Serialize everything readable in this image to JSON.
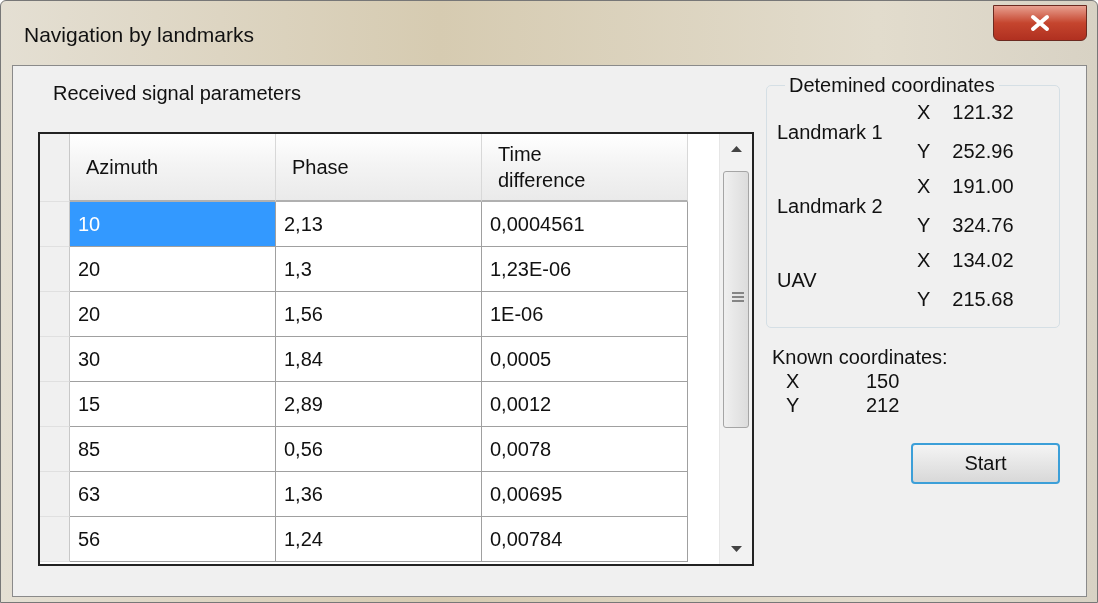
{
  "window": {
    "title": "Navigation by landmarks"
  },
  "section_label": "Received signal parameters",
  "table": {
    "columns": [
      "Azimuth",
      "Phase",
      "Time difference"
    ],
    "rows": [
      {
        "cells": [
          {
            "text": "10",
            "selected": true
          },
          {
            "text": "2,13",
            "selected": false
          },
          {
            "text": "0,0004561",
            "selected": false
          }
        ]
      },
      {
        "cells": [
          {
            "text": "20",
            "selected": false
          },
          {
            "text": "1,3",
            "selected": false
          },
          {
            "text": "1,23E-06",
            "selected": false
          }
        ]
      },
      {
        "cells": [
          {
            "text": "20",
            "selected": false
          },
          {
            "text": "1,56",
            "selected": false
          },
          {
            "text": "1E-06",
            "selected": false
          }
        ]
      },
      {
        "cells": [
          {
            "text": "30",
            "selected": false
          },
          {
            "text": "1,84",
            "selected": false
          },
          {
            "text": "0,0005",
            "selected": false
          }
        ]
      },
      {
        "cells": [
          {
            "text": "15",
            "selected": false
          },
          {
            "text": "2,89",
            "selected": false
          },
          {
            "text": "0,0012",
            "selected": false
          }
        ]
      },
      {
        "cells": [
          {
            "text": "85",
            "selected": false
          },
          {
            "text": "0,56",
            "selected": false
          },
          {
            "text": "0,0078",
            "selected": false
          }
        ]
      },
      {
        "cells": [
          {
            "text": "63",
            "selected": false
          },
          {
            "text": "1,36",
            "selected": false
          },
          {
            "text": "0,00695",
            "selected": false
          }
        ]
      },
      {
        "cells": [
          {
            "text": "56",
            "selected": false
          },
          {
            "text": "1,24",
            "selected": false
          },
          {
            "text": "0,00784",
            "selected": false
          }
        ]
      }
    ]
  },
  "determined": {
    "title": "Detemined coordinates",
    "items": [
      {
        "label": "Landmark 1",
        "coords": [
          {
            "axis": "X",
            "value": "121.32"
          },
          {
            "axis": "Y",
            "value": "252.96"
          }
        ]
      },
      {
        "label": "Landmark 2",
        "coords": [
          {
            "axis": "X",
            "value": "191.00"
          },
          {
            "axis": "Y",
            "value": "324.76"
          }
        ]
      },
      {
        "label": "UAV",
        "coords": [
          {
            "axis": "X",
            "value": "134.02"
          },
          {
            "axis": "Y",
            "value": "215.68"
          }
        ]
      }
    ]
  },
  "known": {
    "label": "Known coordinates:",
    "coords": [
      {
        "axis": "X",
        "value": "150"
      },
      {
        "axis": "Y",
        "value": "212"
      }
    ]
  },
  "buttons": [
    "Start"
  ]
}
